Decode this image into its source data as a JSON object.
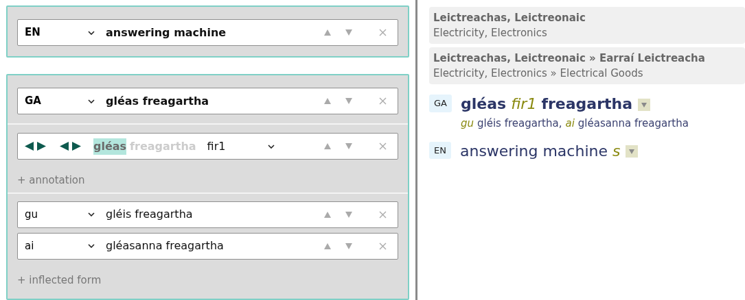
{
  "term_blocks": [
    {
      "term": {
        "lang": "EN",
        "text": "answering machine"
      }
    },
    {
      "term": {
        "lang": "GA",
        "text": "gléas freagartha"
      },
      "gender_row": {
        "words": [
          {
            "text": "gléas",
            "selected": true
          },
          {
            "text": "freagartha",
            "selected": false
          }
        ],
        "value": "fir1"
      },
      "add_annotation": "+ annotation",
      "inflected_forms": [
        {
          "label": "gu",
          "text": "gléis freagartha"
        },
        {
          "label": "ai",
          "text": "gléasanna freagartha"
        }
      ],
      "add_inflected": "+ inflected form"
    }
  ],
  "domains": [
    {
      "ga": "Leictreachas, Leictreonaic",
      "en": "Electricity, Electronics"
    },
    {
      "ga": "Leictreachas, Leictreonaic » Earraí Leictreacha",
      "en": "Electricity, Electronics » Electrical Goods"
    }
  ],
  "preview": [
    {
      "lang": "GA",
      "bold": true,
      "parts": [
        {
          "kind": "word",
          "text": "gléas"
        },
        {
          "kind": "grammar",
          "text": "fir1"
        },
        {
          "kind": "word",
          "text": "freagartha"
        }
      ],
      "inflections": [
        {
          "label": "gu",
          "text": "gléis freagartha,"
        },
        {
          "label": "ai",
          "text": "gléasanna freagartha"
        }
      ]
    },
    {
      "lang": "EN",
      "bold": false,
      "parts": [
        {
          "kind": "word",
          "text": "answering machine"
        },
        {
          "kind": "grammar",
          "text": "s"
        }
      ]
    }
  ]
}
